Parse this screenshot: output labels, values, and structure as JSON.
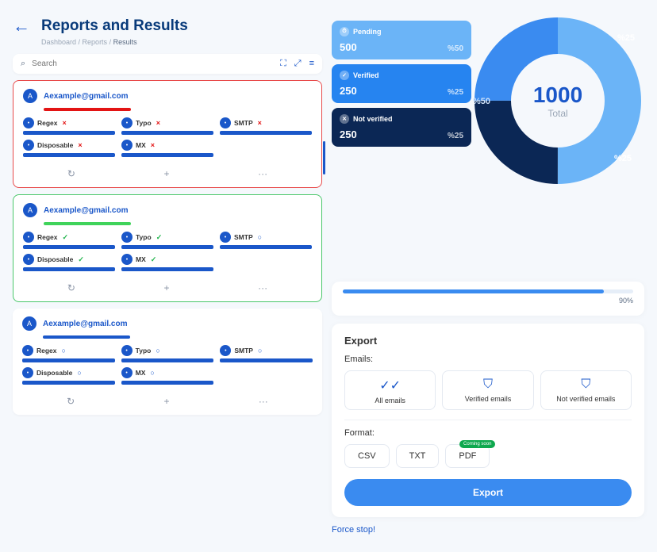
{
  "header": {
    "title": "Reports and Results"
  },
  "breadcrumbs": {
    "a": "Dashboard",
    "b": "Reports",
    "c": "Results",
    "sep": " / "
  },
  "search": {
    "placeholder": "Search"
  },
  "cards": [
    {
      "avatar": "A",
      "email": "Aexample@gmail.com",
      "tone": "red",
      "checks": [
        {
          "label": "Regex",
          "mark": "x"
        },
        {
          "label": "Typo",
          "mark": "x"
        },
        {
          "label": "SMTP",
          "mark": "x"
        },
        {
          "label": "Disposable",
          "mark": "x"
        },
        {
          "label": "MX",
          "mark": "x"
        }
      ]
    },
    {
      "avatar": "A",
      "email": "Aexample@gmail.com",
      "tone": "green",
      "checks": [
        {
          "label": "Regex",
          "mark": "v"
        },
        {
          "label": "Typo",
          "mark": "v"
        },
        {
          "label": "SMTP",
          "mark": "o"
        },
        {
          "label": "Disposable",
          "mark": "v"
        },
        {
          "label": "MX",
          "mark": "v"
        }
      ]
    },
    {
      "avatar": "A",
      "email": "Aexample@gmail.com",
      "tone": "plain",
      "checks": [
        {
          "label": "Regex",
          "mark": "o"
        },
        {
          "label": "Typo",
          "mark": "o"
        },
        {
          "label": "SMTP",
          "mark": "o"
        },
        {
          "label": "Disposable",
          "mark": "o"
        },
        {
          "label": "MX",
          "mark": "o"
        }
      ]
    }
  ],
  "icons": {
    "refresh": "↻",
    "plus": "+",
    "more": "···",
    "back": "←",
    "search": "⌕",
    "scan": "⛶",
    "expand": "⤢",
    "list": "≡"
  },
  "stats": {
    "pending": {
      "label": "Pending",
      "value": "500",
      "pct": "%50"
    },
    "verified": {
      "label": "Verified",
      "value": "250",
      "pct": "%25"
    },
    "notverified": {
      "label": "Not verified",
      "value": "250",
      "pct": "%25"
    }
  },
  "donut": {
    "total": "1000",
    "sub": "Total",
    "seg1": "%25",
    "seg2": "%50",
    "seg3": "%25"
  },
  "progress": {
    "pct_label": "90%",
    "pct": 90
  },
  "export": {
    "title": "Export",
    "emails_label": "Emails:",
    "opt_all": "All emails",
    "opt_verified": "Verified emails",
    "opt_notverified": "Not verified emails",
    "format_label": "Format:",
    "fmt_csv": "CSV",
    "fmt_txt": "TXT",
    "fmt_pdf": "PDF",
    "badge": "Coming soon",
    "button": "Export",
    "force_stop": "Force stop!"
  },
  "marks": {
    "x": "×",
    "v": "✓",
    "o": "○"
  },
  "chart_data": {
    "type": "pie",
    "title": "Total",
    "series": [
      {
        "name": "Pending",
        "value": 500,
        "pct": 50,
        "color": "#6bb4f7"
      },
      {
        "name": "Verified",
        "value": 250,
        "pct": 25,
        "color": "#3a8bf0"
      },
      {
        "name": "Not verified",
        "value": 250,
        "pct": 25,
        "color": "#0b2755"
      }
    ],
    "total": 1000
  }
}
